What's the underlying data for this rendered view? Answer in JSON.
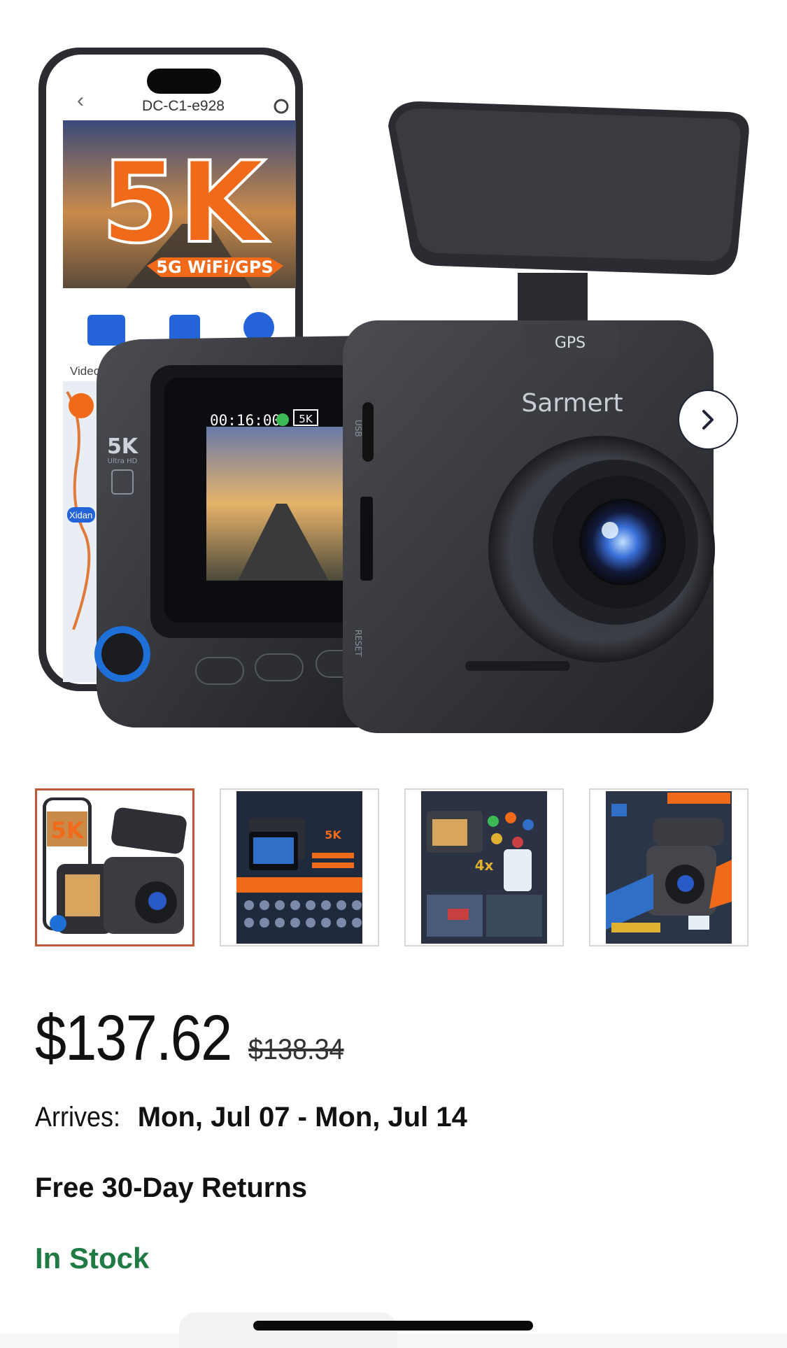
{
  "product": {
    "brand": "Sarmert",
    "phone_device_name": "DC-C1-e928",
    "banner_big_text": "5K",
    "banner_sub_text": "5G WiFi/GPS",
    "screen_time": "00:16:00",
    "screen_res_badge": "5K",
    "side_label": "5K",
    "side_label_sub": "Ultra HD",
    "mount_badge": "GPS",
    "port_usb": "USB",
    "port_reset": "RESET",
    "app_video_label": "Video",
    "map_place": "Xidan"
  },
  "gallery": {
    "thumbnails": [
      {
        "name": "thumbnail-1",
        "selected": true
      },
      {
        "name": "thumbnail-2",
        "selected": false
      },
      {
        "name": "thumbnail-3",
        "selected": false
      },
      {
        "name": "thumbnail-4",
        "selected": false
      }
    ],
    "next_icon": "chevron-right-icon"
  },
  "pricing": {
    "current_price": "$137.62",
    "original_price": "$138.34"
  },
  "delivery": {
    "arrives_label": "Arrives:",
    "arrives_dates": "Mon, Jul 07 - Mon, Jul 14"
  },
  "returns": {
    "text": "Free 30-Day Returns"
  },
  "availability": {
    "text": "In Stock",
    "color": "#1f7a43"
  },
  "colors": {
    "selected_thumb_border": "#c0573a",
    "banner_orange": "#f06a1a"
  }
}
